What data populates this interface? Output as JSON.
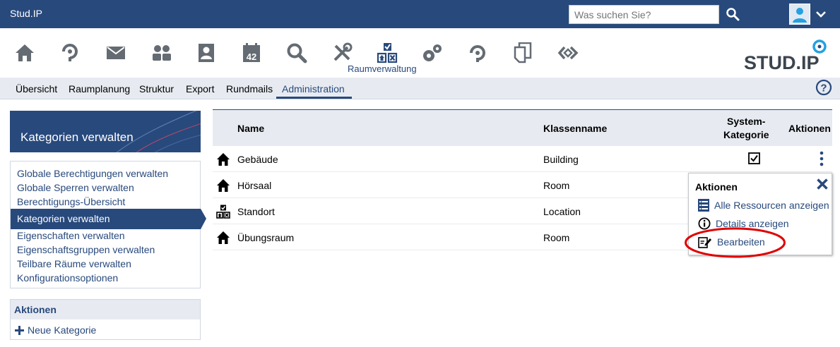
{
  "app": {
    "brand": "Stud.IP"
  },
  "search": {
    "placeholder": "Was suchen Sie?"
  },
  "navigation": {
    "icons": [
      "home-icon",
      "courses-icon",
      "messages-icon",
      "community-icon",
      "profile-icon",
      "calendar-icon",
      "search-nav-icon",
      "tools-icon",
      "resources-icon",
      "admin-icon",
      "files-icon",
      "documents-icon",
      "plugins-icon"
    ],
    "active_label": "Raumverwaltung",
    "logo_text": "STUD.IP"
  },
  "tabs": [
    {
      "label": "Übersicht",
      "active": false
    },
    {
      "label": "Raumplanung",
      "active": false
    },
    {
      "label": "Struktur",
      "active": false
    },
    {
      "label": "Export",
      "active": false
    },
    {
      "label": "Rundmails",
      "active": false
    },
    {
      "label": "Administration",
      "active": true
    }
  ],
  "sidebar": {
    "title": "Kategorien verwalten",
    "links": [
      {
        "label": "Globale Berechtigungen verwalten",
        "active": false
      },
      {
        "label": "Globale Sperren verwalten",
        "active": false
      },
      {
        "label": "Berechtigungs-Übersicht",
        "active": false
      },
      {
        "label": "Kategorien verwalten",
        "active": true
      },
      {
        "label": "Eigenschaften verwalten",
        "active": false
      },
      {
        "label": "Eigenschaftsgruppen verwalten",
        "active": false
      },
      {
        "label": "Teilbare Räume verwalten",
        "active": false
      },
      {
        "label": "Konfigurationsoptionen",
        "active": false
      }
    ],
    "actions_title": "Aktionen",
    "actions": [
      {
        "label": "Neue Kategorie",
        "icon": "plus-icon"
      }
    ]
  },
  "table": {
    "headers": {
      "name": "Name",
      "classname": "Klassenname",
      "system_line1": "System-",
      "system_line2": "Kategorie",
      "actions": "Aktionen"
    },
    "rows": [
      {
        "icon": "house-icon",
        "name": "Gebäude",
        "classname": "Building",
        "system": true
      },
      {
        "icon": "house-icon",
        "name": "Hörsaal",
        "classname": "Room",
        "system": false
      },
      {
        "icon": "location-icon",
        "name": "Standort",
        "classname": "Location",
        "system": false
      },
      {
        "icon": "house-icon",
        "name": "Übungsraum",
        "classname": "Room",
        "system": false
      }
    ]
  },
  "action_menu": {
    "title": "Aktionen",
    "items": [
      {
        "label": "Alle Ressourcen anzeigen",
        "icon": "list-icon"
      },
      {
        "label": "Details anzeigen",
        "icon": "info-icon"
      },
      {
        "label": "Bearbeiten",
        "icon": "edit-icon",
        "highlighted": true
      }
    ]
  },
  "colors": {
    "brand": "#28497c",
    "light": "#e7ebf1",
    "highlight": "#e00000"
  }
}
